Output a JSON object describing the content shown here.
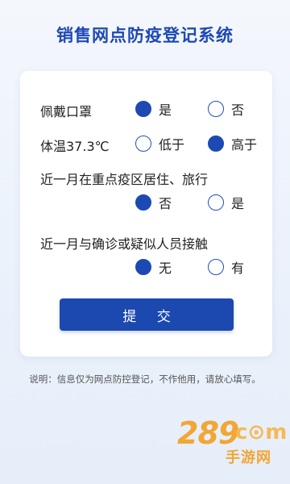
{
  "header": {
    "title": "销售网点防疫登记系统"
  },
  "form": {
    "questions": [
      {
        "label": "佩戴口罩",
        "options": [
          "是",
          "否"
        ],
        "selected": 0
      },
      {
        "label": "体温37.3℃",
        "options": [
          "低于",
          "高于"
        ],
        "selected": 1
      },
      {
        "label": "近一月在重点疫区居住、旅行",
        "options": [
          "否",
          "是"
        ],
        "selected": 0
      },
      {
        "label": "近一月与确诊或疑似人员接触",
        "options": [
          "无",
          "有"
        ],
        "selected": 0
      }
    ],
    "submit_label": "提 交"
  },
  "footer": {
    "note": "说明：信息仅为网点防控登记，不作他用，请放心填写。"
  },
  "watermark": {
    "number": "289",
    "suffix": "c⊙m",
    "subtitle": "手游网"
  },
  "colors": {
    "primary": "#1d49b3",
    "background": "#eaf1fb",
    "watermark": "#f2a634"
  }
}
